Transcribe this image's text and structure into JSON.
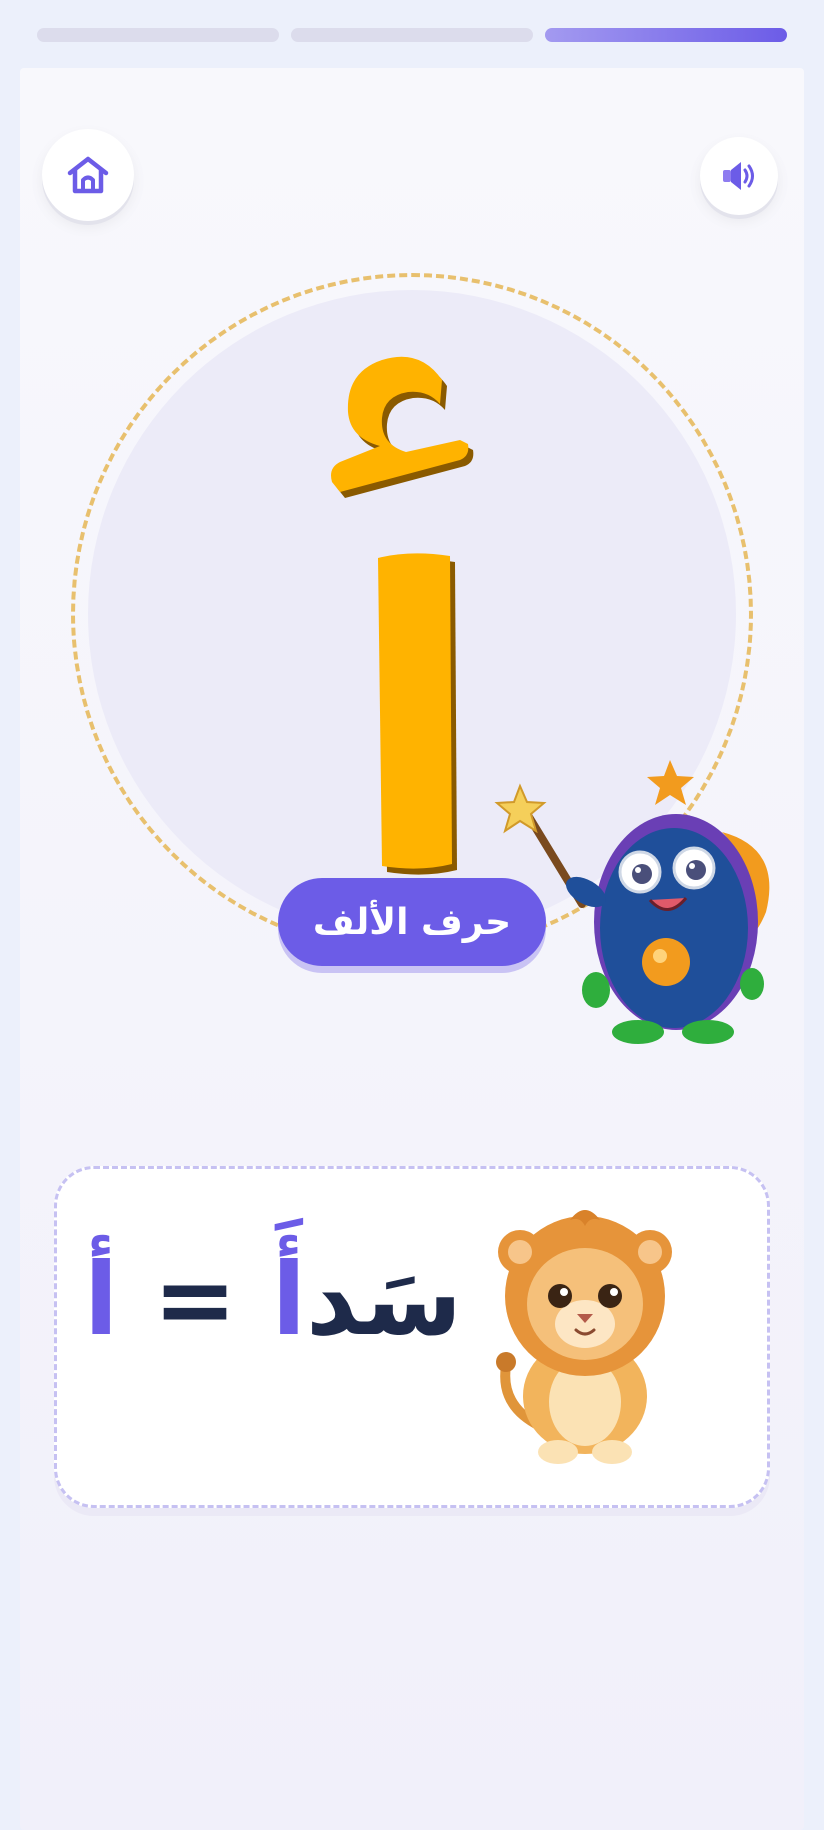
{
  "progress": {
    "total_steps": 3,
    "current_step": 3
  },
  "header": {
    "home_icon": "home-icon",
    "sound_icon": "speaker-icon"
  },
  "letter": {
    "hamza": "ء",
    "alif": "ا",
    "combined": "أ",
    "name": "حرف الألف",
    "color": "#ffb300"
  },
  "example": {
    "letter": "أ",
    "equals": "=",
    "word_first_letter": "أَ",
    "word_rest": "سَد",
    "image": "lion-cub"
  },
  "colors": {
    "accent": "#6c5ce7",
    "letter": "#ffb300",
    "text_dark": "#1e2a4a",
    "dashed_circle": "#e8c06e"
  }
}
